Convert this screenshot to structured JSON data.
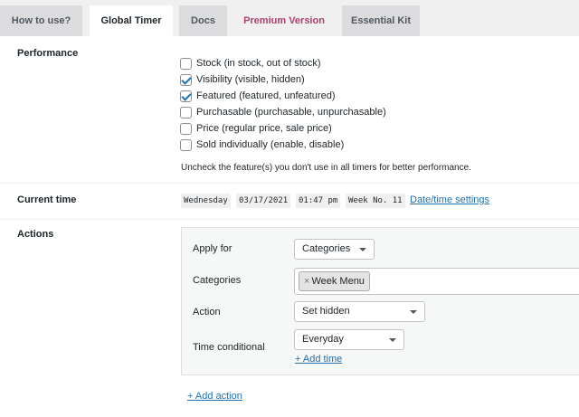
{
  "tabs": [
    {
      "label": "How to use?"
    },
    {
      "label": "Global Timer"
    },
    {
      "label": "Docs"
    },
    {
      "label": "Premium Version"
    },
    {
      "label": "Essential Kit"
    }
  ],
  "performance": {
    "label": "Performance",
    "options": [
      {
        "label": "Stock (in stock, out of stock)",
        "checked": false
      },
      {
        "label": "Visibility (visible, hidden)",
        "checked": true
      },
      {
        "label": "Featured (featured, unfeatured)",
        "checked": true
      },
      {
        "label": "Purchasable (purchasable, unpurchasable)",
        "checked": false
      },
      {
        "label": "Price (regular price, sale price)",
        "checked": false
      },
      {
        "label": "Sold individually (enable, disable)",
        "checked": false
      }
    ],
    "note": "Uncheck the feature(s) you don't use in all timers for better performance."
  },
  "current_time": {
    "label": "Current time",
    "day": "Wednesday",
    "date": "03/17/2021",
    "time": "01:47 pm",
    "week": "Week No. 11",
    "settings_link": "Date/time settings"
  },
  "actions": {
    "label": "Actions",
    "apply_for_label": "Apply for",
    "apply_for_value": "Categories",
    "categories_label": "Categories",
    "categories_selected": [
      "Week Menu"
    ],
    "chip_remove_glyph": "×",
    "action_label": "Action",
    "action_value": "Set hidden",
    "time_conditional_label": "Time conditional",
    "time_conditional_value": "Everyday",
    "add_time_link": "+ Add time",
    "add_action_link": "+ Add action"
  },
  "colors": {
    "accent": "#2271b1",
    "premium": "#b0406f",
    "page_bg": "#f0f0f1",
    "tab_inactive_bg": "#dcdcde"
  }
}
